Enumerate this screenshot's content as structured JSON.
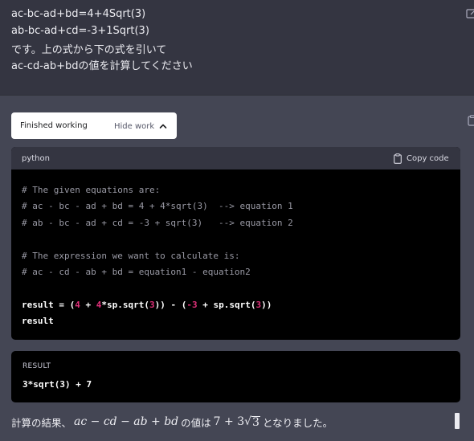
{
  "user": {
    "lines": [
      "ac-bc-ad+bd=4+4Sqrt(3)",
      "ab-bc-ad+cd=-3+1Sqrt(3)",
      "です。上の式から下の式を引いて",
      "ac-cd-ab+bdの値を計算してください"
    ],
    "edit_icon": "edit-icon"
  },
  "assistant": {
    "copy_icon": "clipboard-icon",
    "work": {
      "status": "Finished working",
      "toggle_label": "Hide work",
      "toggle_icon": "chevron-up-icon"
    },
    "code": {
      "language": "python",
      "copy_label": "Copy code",
      "copy_icon": "clipboard-icon",
      "lines": {
        "c1": "# The given equations are:",
        "c2": "# ac - bc - ad + bd = 4 + 4*sqrt(3)  --> equation 1",
        "c3": "# ab - bc - ad + cd = -3 + sqrt(3)   --> equation 2",
        "c4": "# The expression we want to calculate is:",
        "c5": "# ac - cd - ab + bd = equation1 - equation2",
        "r1": {
          "a": "result = (",
          "b": "4",
          "c": " + ",
          "d": "4",
          "e": "*sp.sqrt(",
          "f": "3",
          "g": ")) - (",
          "h": "-3",
          "i": " + sp.sqrt(",
          "j": "3",
          "k": "))"
        },
        "r2": "result"
      }
    },
    "result": {
      "label": "RESULT",
      "value": "3*sqrt(3) + 7"
    },
    "answer": {
      "prefix": "計算の結果、",
      "expr": "ac − cd − ab + bd",
      "middle": "の値は",
      "value_int": "7 + 3",
      "value_radicand": "3",
      "suffix": "となりました。"
    }
  },
  "colors": {
    "user_bg": "#343541",
    "assistant_bg": "#444654",
    "code_bg": "#000000",
    "number_accent": "#df3079"
  }
}
